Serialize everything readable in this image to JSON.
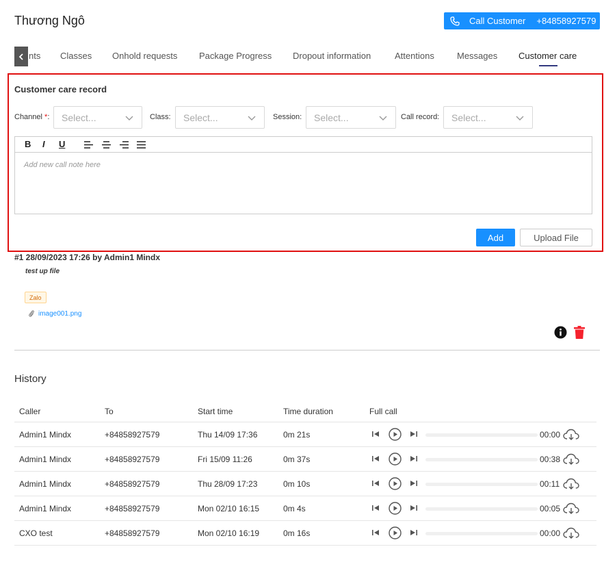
{
  "header": {
    "title": "Thương Ngô",
    "call_button_label": "Call Customer",
    "call_button_number": "+84858927579"
  },
  "tabs": {
    "prev_icon": "chevron-left-icon",
    "items": [
      {
        "label": "nts"
      },
      {
        "label": "Classes"
      },
      {
        "label": "Onhold requests"
      },
      {
        "label": "Package Progress"
      },
      {
        "label": "Dropout information"
      },
      {
        "label": "Attentions"
      },
      {
        "label": "Messages"
      },
      {
        "label": "Customer care"
      }
    ],
    "active": "Customer care"
  },
  "care_form": {
    "title": "Customer care record",
    "channel_label": "Channel",
    "channel_required": "*",
    "channel_colon": ":",
    "channel_placeholder": "Select...",
    "class_label": "Class:",
    "class_placeholder": "Select...",
    "session_label": "Session:",
    "session_placeholder": "Select...",
    "call_record_label": "Call record:",
    "call_record_placeholder": "Select...",
    "toolbar": {
      "bold": "B",
      "italic": "I",
      "underline": "U"
    },
    "editor_placeholder": "Add new call note here",
    "add_label": "Add",
    "upload_label": "Upload File"
  },
  "record": {
    "heading": "#1 28/09/2023 17:26 by Admin1 Mindx",
    "note": "test up file",
    "tag": "Zalo",
    "attachment": "image001.png"
  },
  "history": {
    "title": "History",
    "columns": [
      "Caller",
      "To",
      "Start time",
      "Time duration",
      "Full call"
    ],
    "rows": [
      {
        "caller": "Admin1 Mindx",
        "to": "+84858927579",
        "start": "Thu 14/09 17:36",
        "duration": "0m 21s",
        "time": "00:00",
        "progress": 0
      },
      {
        "caller": "Admin1 Mindx",
        "to": "+84858927579",
        "start": "Fri 15/09 11:26",
        "duration": "0m 37s",
        "time": "00:38",
        "progress": 0
      },
      {
        "caller": "Admin1 Mindx",
        "to": "+84858927579",
        "start": "Thu 28/09 17:23",
        "duration": "0m 10s",
        "time": "00:11",
        "progress": 0
      },
      {
        "caller": "Admin1 Mindx",
        "to": "+84858927579",
        "start": "Mon 02/10 16:15",
        "duration": "0m 4s",
        "time": "00:05",
        "progress": 0
      },
      {
        "caller": "CXO test",
        "to": "+84858927579",
        "start": "Mon 02/10 16:19",
        "duration": "0m 16s",
        "time": "00:00",
        "progress": 0
      }
    ]
  },
  "colors": {
    "primary": "#1890ff",
    "highlight_border": "#e01010",
    "delete": "#f5222d",
    "tab_underline": "#333a80"
  }
}
